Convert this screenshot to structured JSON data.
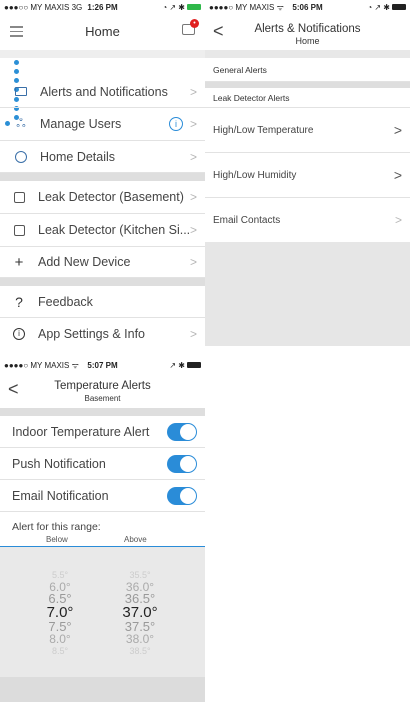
{
  "p1": {
    "status": {
      "carrier": "●●●○○ MY MAXIS  3G",
      "time": "1:26 PM",
      "right": "◔ ↗ ✱"
    },
    "title": "Home",
    "badge": "•",
    "items": [
      {
        "label": "Alerts and Notifications"
      },
      {
        "label": "Manage Users"
      },
      {
        "label": "Home Details"
      },
      {
        "label": "Leak Detector (Basement)"
      },
      {
        "label": "Leak Detector (Kitchen Si..."
      },
      {
        "label": "Add New Device"
      },
      {
        "label": "Feedback"
      },
      {
        "label": "App Settings & Info"
      }
    ],
    "info_badge": "i"
  },
  "p2": {
    "status": {
      "carrier": "●●●●○ MY MAXIS ᯤ",
      "time": "5:06 PM",
      "right": "◔ ↗ ✱"
    },
    "title": "Alerts & Notifications",
    "subtitle": "Home",
    "section1": "General Alerts",
    "section2": "Leak Detector Alerts",
    "rows": [
      "High/Low Temperature",
      "High/Low Humidity",
      "Email Contacts"
    ]
  },
  "p3": {
    "status": {
      "carrier": "●●●●○ MY MAXIS ᯤ",
      "time": "5:07 PM",
      "right": "↗ ✱"
    },
    "title": "Temperature Alerts",
    "subtitle": "Basement",
    "toggles": [
      {
        "label": "Indoor Temperature Alert",
        "on": true
      },
      {
        "label": "Push Notification",
        "on": true
      },
      {
        "label": "Email Notification",
        "on": true
      }
    ],
    "range_label": "Alert for this range:",
    "below_label": "Below",
    "above_label": "Above",
    "below_values": [
      "5.5°",
      "6.0°",
      "6.5°",
      "7.0°",
      "7.5°",
      "8.0°",
      "8.5°"
    ],
    "above_values": [
      "35.5°",
      "36.0°",
      "36.5°",
      "37.0°",
      "37.5°",
      "38.0°",
      "38.5°"
    ]
  },
  "colors": {
    "accent": "#2a8cd8",
    "separator": "#dedede",
    "empty": "#e6e6e6"
  }
}
